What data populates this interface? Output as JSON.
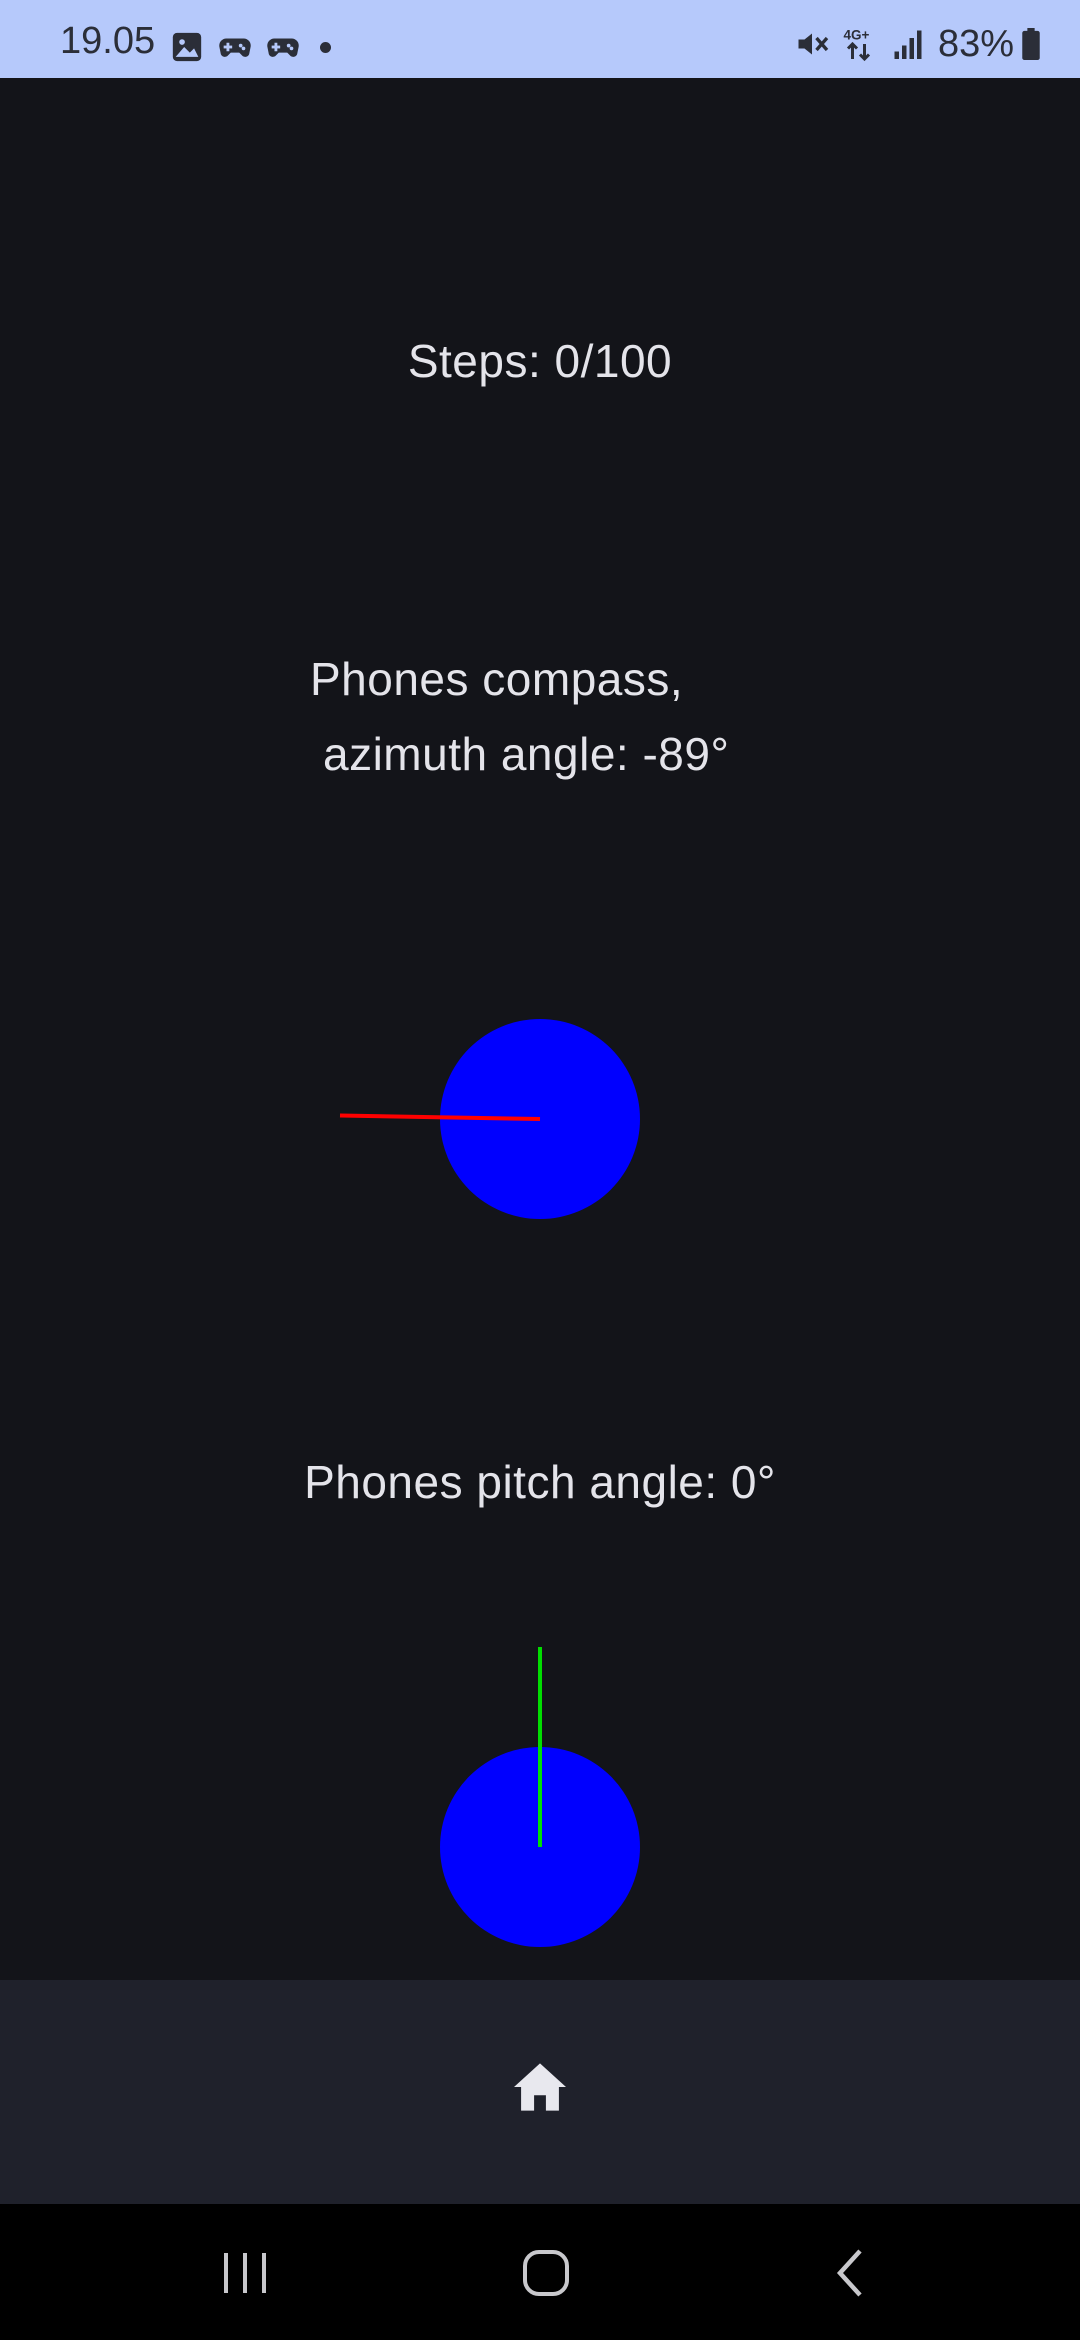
{
  "status_bar": {
    "time": "19.05",
    "battery": "83%",
    "left_icons": [
      "gallery-icon",
      "game-controller-icon",
      "game-controller-icon",
      "notification-dot"
    ],
    "right_icons": [
      "mute-vibrate-icon",
      "4g-plus-data-icon",
      "signal-bars-icon",
      "battery-icon"
    ],
    "network_label": "4G+"
  },
  "steps": {
    "text": "Steps: 0/100"
  },
  "compass": {
    "label_line1": "Phones compass,",
    "label_line2": "azimuth angle: -89°",
    "azimuth_deg": -89,
    "dial_color": "#0000ff",
    "needle_color": "#ff0000"
  },
  "pitch": {
    "label": "Phones pitch angle: 0°",
    "pitch_deg": 0,
    "dial_color": "#0000ff",
    "needle_color": "#00dd00"
  },
  "bottom_nav": {
    "items": [
      {
        "icon": "home-icon",
        "selected": true
      }
    ]
  },
  "system_nav": {
    "buttons": [
      "recent-apps-icon",
      "home-outline-icon",
      "back-icon"
    ]
  },
  "colors": {
    "background": "#131419",
    "status_bar": "#b6c9fb",
    "text": "#e4e4ea",
    "nav_bar": "#1f212b"
  }
}
